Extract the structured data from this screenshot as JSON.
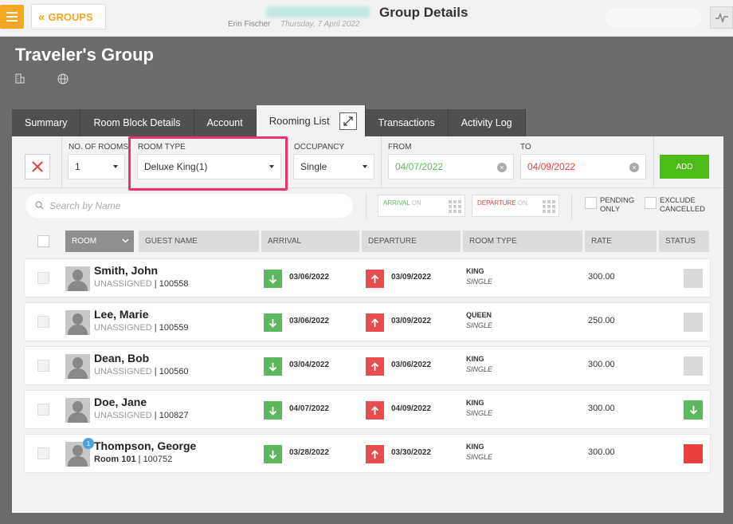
{
  "header": {
    "back_label": "GROUPS",
    "page_title": "Group Details",
    "user_name": "Erin Fischer",
    "date": "Thursday, 7 April 2022"
  },
  "group": {
    "title": "Traveler's Group"
  },
  "tabs": [
    {
      "label": "Summary"
    },
    {
      "label": "Room Block Details"
    },
    {
      "label": "Account"
    },
    {
      "label": "Rooming List",
      "active": true
    },
    {
      "label": "Transactions"
    },
    {
      "label": "Activity Log"
    }
  ],
  "filters": {
    "rooms_label": "NO. OF ROOMS",
    "rooms_value": "1",
    "room_type_label": "ROOM TYPE",
    "room_type_value": "Deluxe King(1)",
    "occupancy_label": "OCCUPANCY",
    "occupancy_value": "Single",
    "from_label": "FROM",
    "from_value": "04/07/2022",
    "to_label": "TO",
    "to_value": "04/09/2022",
    "add_label": "ADD"
  },
  "search": {
    "placeholder": "Search by Name",
    "arrival_label": "ARRIVAL",
    "arrival_state": "ON",
    "departure_label": "DEPARTURE",
    "departure_state": "ON",
    "pending_label": "PENDING ONLY",
    "exclude_label": "EXCLUDE CANCELLED"
  },
  "table": {
    "headers": [
      "ROOM",
      "GUEST NAME",
      "ARRIVAL",
      "DEPARTURE",
      "ROOM TYPE",
      "RATE",
      "STATUS"
    ],
    "rows": [
      {
        "name": "Smith, John",
        "room": "UNASSIGNED",
        "id": "100558",
        "arrival": "03/06/2022",
        "departure": "03/09/2022",
        "type": "KING",
        "occ": "SINGLE",
        "rate": "300.00",
        "status": "none"
      },
      {
        "name": "Lee, Marie",
        "room": "UNASSIGNED",
        "id": "100559",
        "arrival": "03/06/2022",
        "departure": "03/09/2022",
        "type": "QUEEN",
        "occ": "SINGLE",
        "rate": "250.00",
        "status": "none"
      },
      {
        "name": "Dean, Bob",
        "room": "UNASSIGNED",
        "id": "100560",
        "arrival": "03/04/2022",
        "departure": "03/06/2022",
        "type": "KING",
        "occ": "SINGLE",
        "rate": "300.00",
        "status": "none"
      },
      {
        "name": "Doe, Jane",
        "room": "UNASSIGNED",
        "id": "100827",
        "arrival": "04/07/2022",
        "departure": "04/09/2022",
        "type": "KING",
        "occ": "SINGLE",
        "rate": "300.00",
        "status": "arriving"
      },
      {
        "name": "Thompson, George",
        "room": "Room 101",
        "id": "100752",
        "arrival": "03/28/2022",
        "departure": "03/30/2022",
        "type": "KING",
        "occ": "SINGLE",
        "rate": "300.00",
        "status": "departed",
        "badge": "1"
      }
    ]
  },
  "colors": {
    "accent": "#f5a623",
    "add": "#4cbb17",
    "arrival": "#5cb85c",
    "departure": "#e84c4c",
    "highlight": "#e8336d"
  }
}
